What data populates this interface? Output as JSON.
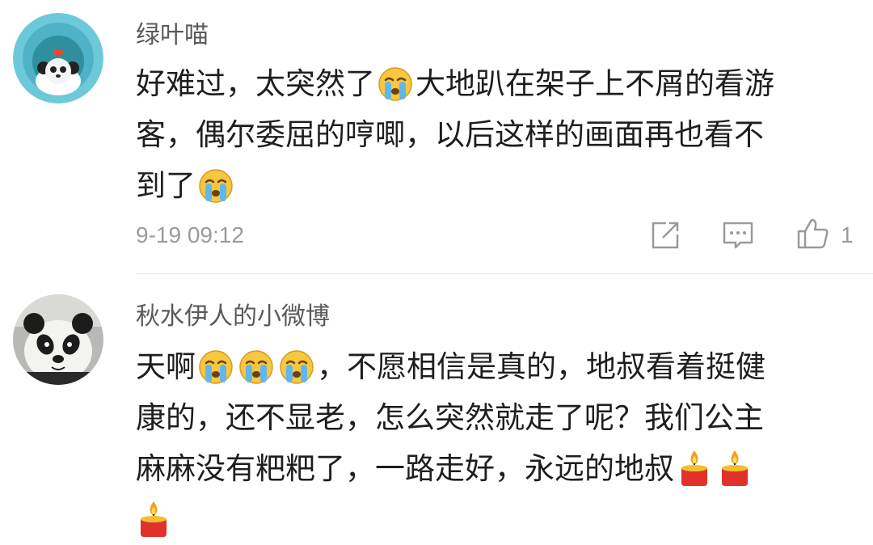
{
  "comments": [
    {
      "username": "绿叶喵",
      "text_lines": [
        "好难过，太突然了",
        "大地趴在架子上不屑的看游",
        "客，偶尔委屈的哼唧，以后这样的画面再也看不",
        "到了"
      ],
      "emojis": [
        "crying-emoji",
        "crying-emoji"
      ],
      "timestamp": "9-19 09:12",
      "actions": [
        "share-icon",
        "comment-icon",
        "like-icon"
      ],
      "like_count": "1"
    },
    {
      "username": "秋水伊人的小微博",
      "text_lines": [
        "天啊",
        "，不愿相信是真的，地叔看着挺健",
        "康的，还不显老，怎么突然就走了呢？我们公主",
        "麻麻没有粑粑了，一路走好，永远的地叔"
      ],
      "emojis": [
        "crying-emoji",
        "crying-emoji",
        "crying-emoji",
        "candle-emoji",
        "candle-emoji",
        "candle-emoji"
      ]
    }
  ],
  "colors": {
    "username": "#5a5a5a",
    "text": "#1e1e1e",
    "meta": "#9a9a9a",
    "avatar_ring": "#6cc9d9"
  }
}
